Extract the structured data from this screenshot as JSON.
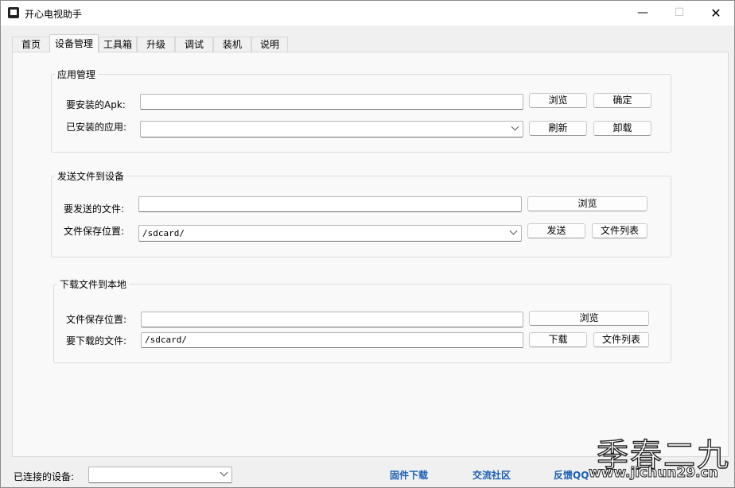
{
  "window": {
    "title": "开心电视助手",
    "minimize_glyph": "—",
    "maximize_glyph": "☐",
    "close_glyph": "✕"
  },
  "tabs": [
    {
      "label": "首页"
    },
    {
      "label": "设备管理",
      "active": true
    },
    {
      "label": "工具箱"
    },
    {
      "label": "升级"
    },
    {
      "label": "调试"
    },
    {
      "label": "装机"
    },
    {
      "label": "说明"
    }
  ],
  "app_manage": {
    "legend": "应用管理",
    "apk_label": "要安装的Apk:",
    "apk_value": "",
    "installed_label": "已安装的应用:",
    "installed_value": "",
    "browse": "浏览",
    "confirm": "确定",
    "refresh": "刷新",
    "uninstall": "卸载"
  },
  "send_file": {
    "legend": "发送文件到设备",
    "file_label": "要发送的文件:",
    "file_value": "",
    "save_label": "文件保存位置:",
    "save_value": "/sdcard/",
    "browse": "浏览",
    "send": "发送",
    "file_list": "文件列表"
  },
  "download_file": {
    "legend": "下载文件到本地",
    "save_label": "文件保存位置:",
    "save_value": "",
    "file_label": "要下载的文件:",
    "file_value": "/sdcard/",
    "browse": "浏览",
    "download": "下载",
    "file_list": "文件列表"
  },
  "statusbar": {
    "connected_label": "已连接的设备:",
    "connected_value": "",
    "firmware_link": "固件下载",
    "community_link": "交流社区",
    "feedback_link": "反馈QQ"
  },
  "watermark": {
    "big": "季春二九",
    "small": "www.jichun29.cn"
  },
  "colors": {
    "link": "#1a5fb4",
    "background": "#f0f0f0",
    "page": "#f9f9f9"
  }
}
